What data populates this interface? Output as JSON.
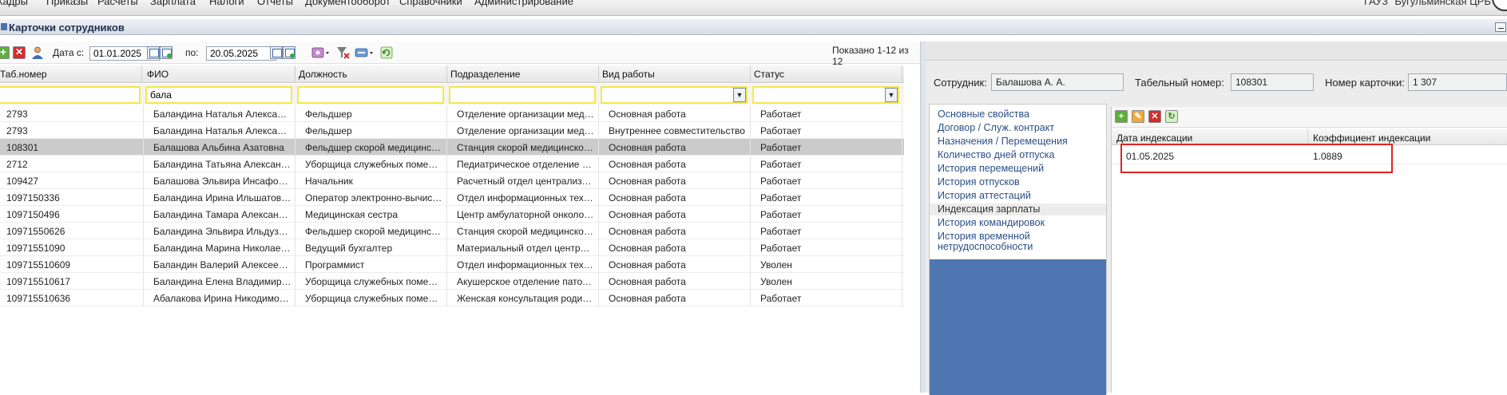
{
  "menu": {
    "items": [
      "Кадры",
      "Приказы",
      "Расчеты",
      "Зарплата",
      "Налоги",
      "Отчеты",
      "Документооборот",
      "Справочники",
      "Администрирование"
    ],
    "organization": "ГАУЗ \"Бугульминская ЦРБ\""
  },
  "window": {
    "title": "Карточки сотрудников"
  },
  "toolbar": {
    "date_from_label": "Дата с:",
    "date_from_value": "01.01.2025",
    "date_to_label": "по:",
    "date_to_value": "20.05.2025",
    "showing_text": "Показано 1-12 из 12"
  },
  "table": {
    "columns": [
      "Таб.номер",
      "ФИО",
      "Должность",
      "Подразделение",
      "Вид работы",
      "Статус"
    ],
    "filter": {
      "fio": "бала"
    },
    "selected_row": 2,
    "rows": [
      [
        "2793",
        "Баландина Наталья Александровна",
        "Фельдшер",
        "Отделение организации медицин...",
        "Основная работа",
        "Работает"
      ],
      [
        "2793",
        "Баландина Наталья Александровна",
        "Фельдшер",
        "Отделение организации медицин...",
        "Внутреннее совместительство",
        "Работает"
      ],
      [
        "108301",
        "Балашова Альбина Азатовна",
        "Фельдшер скорой медицинской п...",
        "Станция скорой медицинской по...",
        "Основная работа",
        "Работает"
      ],
      [
        "2712",
        "Баландина Татьяна Александровна",
        "Уборщица служебных помещений",
        "Педиатрическое отделение стац...",
        "Основная работа",
        "Работает"
      ],
      [
        "109427",
        "Балашова Эльвира Инсафовна",
        "Начальник",
        "Расчетный отдел централизован...",
        "Основная работа",
        "Работает"
      ],
      [
        "1097150336",
        "Баландина Ирина Ильшатовна",
        "Оператор электронно-вычислите...",
        "Отдел информационных техноло...",
        "Основная работа",
        "Работает"
      ],
      [
        "1097150496",
        "Баландина Тамара Александровна",
        "Медицинская сестра",
        "Центр амбулаторной онкологиче...",
        "Основная работа",
        "Работает"
      ],
      [
        "10971550626",
        "Баландина Эльвира Ильдузовна",
        "Фельдшер скорой медицинской п...",
        "Станция скорой медицинской по...",
        "Основная работа",
        "Работает"
      ],
      [
        "10971551090",
        "Баландина Марина Николаевна",
        "Ведущий бухгалтер",
        "Материальный отдел централизо...",
        "Основная работа",
        "Работает"
      ],
      [
        "109715510609",
        "Баландин Валерий Алексеевич",
        "Программист",
        "Отдел информационных техноло...",
        "Основная работа",
        "Уволен"
      ],
      [
        "109715510617",
        "Баландина Елена Владимировна",
        "Уборщица служебных помещений",
        "Акушерское отделение патологи...",
        "Основная работа",
        "Уволен"
      ],
      [
        "109715510636",
        "Абалакова Ирина Никодимовна",
        "Уборщица служебных помещений",
        "Женская консультация родильно...",
        "Основная работа",
        "Работает"
      ]
    ]
  },
  "employee_card": {
    "employee_label": "Сотрудник:",
    "employee_value": "Балашова А. А.",
    "tab_number_label": "Табельный номер:",
    "tab_number_value": "108301",
    "card_number_label": "Номер карточки:",
    "card_number_value": "1 307",
    "nav_items": [
      "Основные свойства",
      "Договор / Служ. контракт",
      "Назначения / Перемещения",
      "Количество дней отпуска",
      "История перемещений",
      "История отпусков",
      "История аттестаций",
      "Индексация зарплаты",
      "История командировок",
      "История временной нетрудоспособности"
    ],
    "active_nav": "Индексация зарплаты",
    "indexation": {
      "columns": [
        "Дата индексации",
        "Коэффициент индексации"
      ],
      "rows": [
        [
          "01.05.2025",
          "1.0889"
        ]
      ]
    }
  },
  "colors": {
    "selected_row": "#cbcbcb",
    "filter_border": "#f5e84a",
    "nav_link": "#2a4f86",
    "nav_fill": "#4e77b2",
    "highlight": "#e02424"
  }
}
